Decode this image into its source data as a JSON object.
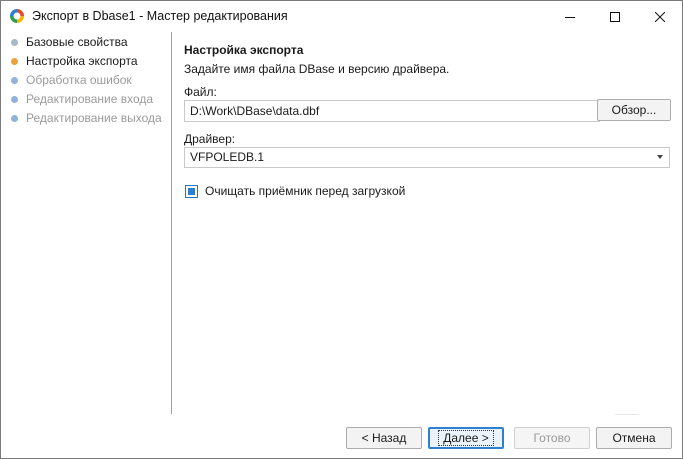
{
  "window": {
    "title": "Экспорт в Dbase1 - Мастер редактирования"
  },
  "steps": [
    {
      "label": "Базовые свойства",
      "state": "done"
    },
    {
      "label": "Настройка экспорта",
      "state": "current"
    },
    {
      "label": "Обработка ошибок",
      "state": "pending"
    },
    {
      "label": "Редактирование входа",
      "state": "pending"
    },
    {
      "label": "Редактирование выхода",
      "state": "pending"
    }
  ],
  "step_colors": {
    "done": "#a8b8c8",
    "current": "#e8a33d",
    "pending": "#8fb3d9",
    "pending_text": "#9a9a9a",
    "active_text": "#1a1a1a"
  },
  "main": {
    "title": "Настройка экспорта",
    "description": "Задайте имя файла DBase и версию драйвера.",
    "file_label": "Файл:",
    "file_value": "D:\\Work\\DBase\\data.dbf",
    "browse_label": "Обзор...",
    "driver_label": "Драйвер:",
    "driver_value": "VFPOLEDB.1",
    "clear_checkbox_label": "Очищать приёмник перед загрузкой",
    "clear_checkbox_checked": true
  },
  "footer": {
    "back_label": "< Назад",
    "next_label": "Далее >",
    "finish_label": "Готово",
    "cancel_label": "Отмена"
  }
}
